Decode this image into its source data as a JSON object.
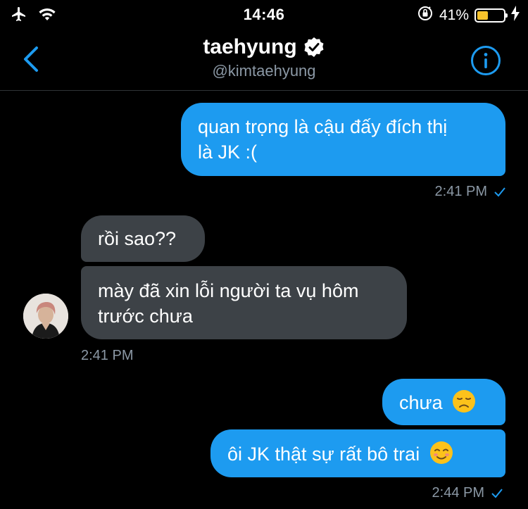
{
  "status_bar": {
    "time": "14:46",
    "battery_percent_text": "41%",
    "battery_level": 0.41,
    "icons": [
      "airplane-icon",
      "wifi-icon",
      "orientation-lock-icon",
      "battery-icon",
      "charging-bolt-icon"
    ]
  },
  "header": {
    "name": "taehyung",
    "handle": "@kimtaehyung",
    "verified": true,
    "back_icon": "chevron-left-icon",
    "info_icon": "info-icon",
    "accent_color": "#1d9bf0"
  },
  "messages": [
    {
      "direction": "sent",
      "lines": [
        "quan trọng là cậu đấy đích thị",
        "là JK :("
      ]
    },
    {
      "meta": "2:41 PM",
      "read": true
    },
    {
      "direction": "received",
      "lines": [
        "rồi sao??"
      ]
    },
    {
      "direction": "received",
      "lines": [
        "mày đã xin lỗi người ta vụ hôm",
        "trước chưa"
      ]
    },
    {
      "meta": "2:41 PM"
    },
    {
      "direction": "sent",
      "lines": [
        "chưa"
      ],
      "emoji": "disappointed-face-emoji"
    },
    {
      "direction": "sent",
      "lines": [
        "ôi JK thật sự rất bô trai"
      ],
      "emoji": "smiling-face-emoji"
    },
    {
      "meta": "2:44 PM",
      "read": true
    }
  ],
  "colors": {
    "sent_bubble": "#1d9bf0",
    "received_bubble": "#3d4247",
    "background": "#000000",
    "muted_text": "#8b98a5"
  }
}
